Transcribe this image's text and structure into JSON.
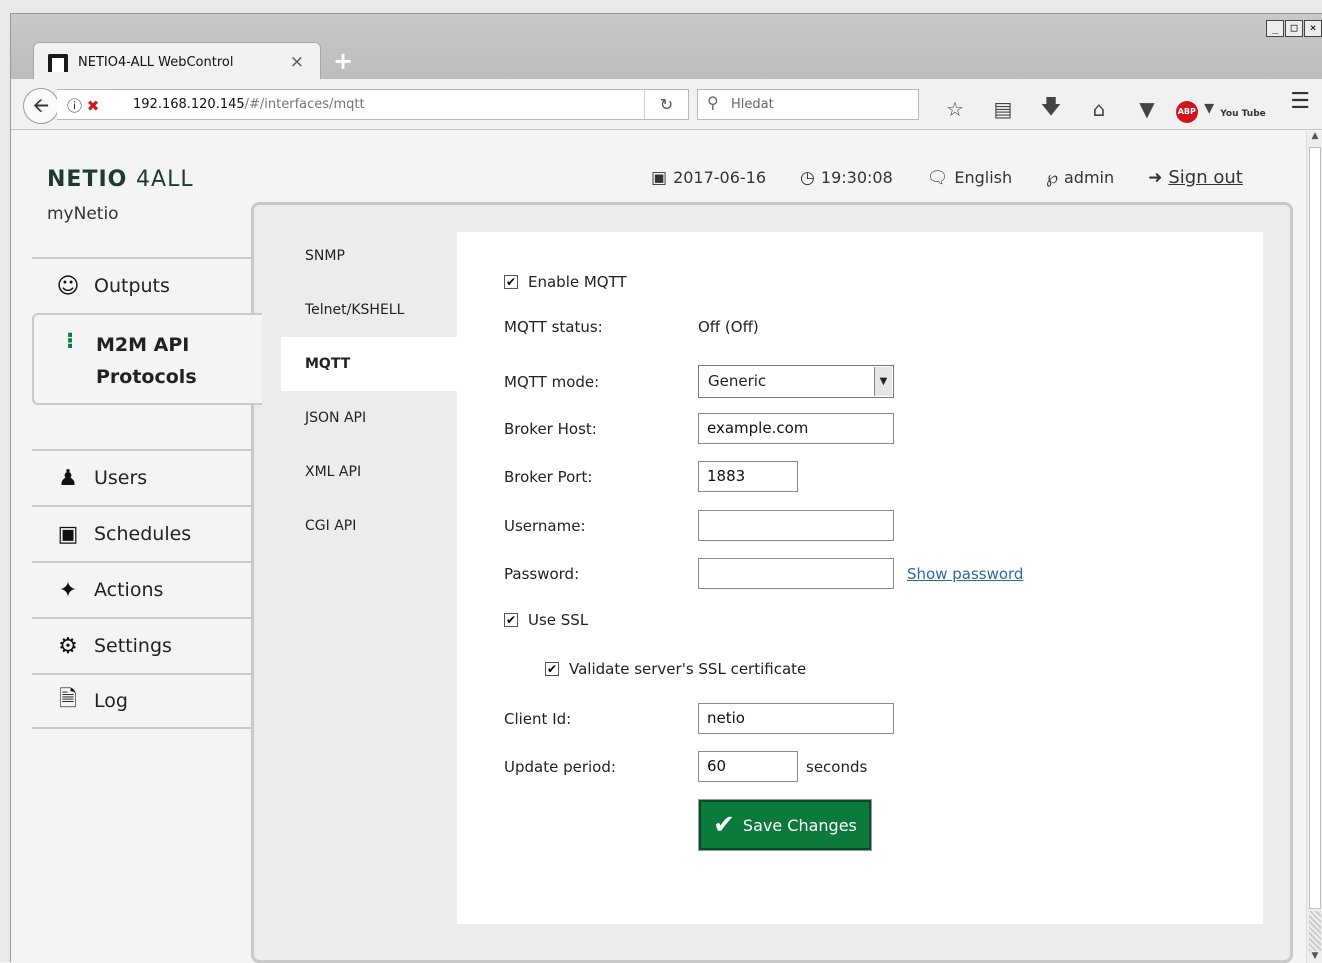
{
  "browser": {
    "tab_title": "NETIO4-ALL WebControl",
    "tab_close": "×",
    "new_tab": "+",
    "url_host": "192.168.120.145",
    "url_path": "/#/interfaces/mqtt",
    "search_placeholder": "Hledat",
    "window_buttons": [
      "_",
      "□",
      "×"
    ],
    "abp_label": "ABP",
    "youtube_label": "You Tube"
  },
  "header": {
    "brand": "NETIO",
    "brand_suffix": "4ALL",
    "device_name": "myNetio",
    "date": "2017-06-16",
    "time": "19:30:08",
    "language": "English",
    "user": "admin",
    "signout": "Sign out"
  },
  "nav": {
    "items": [
      {
        "label": "Outputs",
        "icon": "outputs-icon"
      },
      {
        "label_line1": "M2M API",
        "label_line2": "Protocols",
        "icon": "m2m-icon",
        "active": true
      },
      {
        "label": "Users",
        "icon": "user-icon"
      },
      {
        "label": "Schedules",
        "icon": "calendar-icon"
      },
      {
        "label": "Actions",
        "icon": "wand-icon"
      },
      {
        "label": "Settings",
        "icon": "gear-icon"
      },
      {
        "label": "Log",
        "icon": "document-icon"
      }
    ]
  },
  "subnav": {
    "items": [
      "SNMP",
      "Telnet/KSHELL",
      "MQTT",
      "JSON API",
      "XML API",
      "CGI API"
    ],
    "active": "MQTT"
  },
  "form": {
    "enable_label": "Enable MQTT",
    "enable_checked": true,
    "status_label": "MQTT status:",
    "status_value": "Off (Off)",
    "mode_label": "MQTT mode:",
    "mode_value": "Generic",
    "host_label": "Broker Host:",
    "host_value": "example.com",
    "port_label": "Broker Port:",
    "port_value": "1883",
    "username_label": "Username:",
    "username_value": "",
    "password_label": "Password:",
    "password_value": "",
    "show_password": "Show password",
    "ssl_label": "Use SSL",
    "ssl_checked": true,
    "validate_label": "Validate server's SSL certificate",
    "validate_checked": true,
    "client_label": "Client Id:",
    "client_value": "netio",
    "period_label": "Update period:",
    "period_value": "60",
    "period_unit": "seconds",
    "save_label": "Save Changes"
  },
  "colors": {
    "save_button": "#0c7a3c",
    "brand": "#1d3b32",
    "link": "#2a6aa8"
  }
}
